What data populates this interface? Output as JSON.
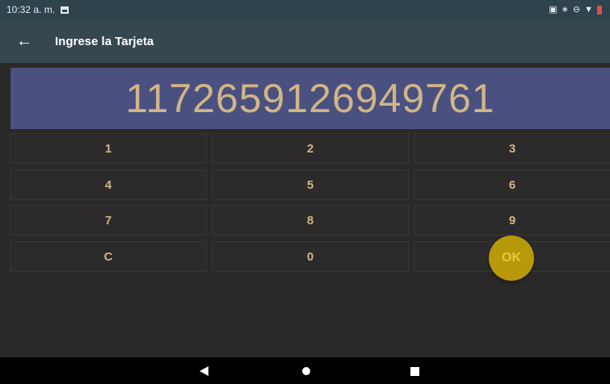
{
  "status_bar": {
    "time": "10:32 a. m.",
    "icons": [
      "image-icon",
      "vibrate-icon",
      "bluetooth-icon",
      "do-not-disturb-icon",
      "wifi-icon",
      "battery-low-icon"
    ]
  },
  "app_bar": {
    "title": "Ingrese la Tarjeta"
  },
  "display": {
    "value": "1172659126949761"
  },
  "keypad": {
    "keys": [
      "1",
      "2",
      "3",
      "4",
      "5",
      "6",
      "7",
      "8",
      "9",
      "C",
      "0"
    ],
    "ok_label": "OK"
  },
  "colors": {
    "status_bar": "#2e434c",
    "app_bar": "#36474f",
    "display_bg": "#4a5080",
    "digit_text": "#d0b586",
    "ok_button": "#b8990a",
    "background": "#2b2828"
  }
}
